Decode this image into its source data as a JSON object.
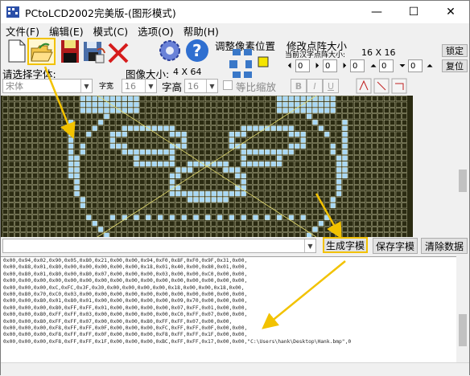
{
  "window": {
    "title": "PCtoLCD2002完美版-(图形模式)",
    "minimize": "—",
    "maximize": "☐",
    "close": "✕"
  },
  "menu": [
    "文件(F)",
    "编辑(E)",
    "模式(C)",
    "选项(O)",
    "帮助(H)"
  ],
  "toolbar": {
    "adjust_pixel_label": "调整像素位置",
    "resize_label": "修改点阵大小",
    "current_size_caption": "当前汉字点阵大小:",
    "current_size_value": "16 X 16",
    "lock_label": "锁定",
    "restore_label": "复位",
    "spin_values": [
      "0",
      "0",
      "0",
      "0",
      "0",
      "0",
      "0"
    ],
    "select_font_label": "请选择字体:",
    "font_value": "宋体",
    "char_width_label": "字宽",
    "char_width_value": "16",
    "image_size_label": "图像大小:",
    "image_size_value": "4 X 64",
    "char_height_label": "字高",
    "char_height_value": "16",
    "proportional_label": "等比缩放",
    "bold": "B",
    "italic": "I",
    "underline": "U"
  },
  "canvas": {
    "bg": "#2b2b12",
    "pixel_on": "#a9d8f5",
    "grid": "#f0f0c8"
  },
  "actions": {
    "generate": "生成字模",
    "save": "保存字模",
    "clear": "清除数据"
  },
  "output_lines": [
    "0x00,0x94,0x02,0x90,0x05,0x80,0x21,0x00,0x00,0x94,0xF0,0x8F,0xF0,0x9F,0x31,0x00,",
    "0x00,0x88,0x01,0x80,0x00,0x00,0x00,0x00,0x00,0x18,0x01,0x40,0x00,0x80,0x01,0x00,",
    "0x00,0x80,0x01,0x80,0x00,0x80,0x07,0x00,0x00,0x00,0x03,0x00,0x00,0xC0,0x00,0x00,",
    "0x00,0x00,0x00,0x00,0x00,0x00,0x00,0x00,0x00,0x00,0x00,0x00,0x00,0x00,0x00,0x00,",
    "0x00,0x00,0x00,0xC,0xFC,0x3F,0x30,0x00,0x00,0x00,0x00,0x18,0x00,0x00,0x18,0x00,",
    "0x00,0x80,0x70,0xC0,0x03,0x00,0x00,0x00,0x00,0x00,0x00,0x00,0x00,0x00,0x00,0x00,",
    "0x00,0x00,0x80,0x01,0x80,0x01,0x00,0x00,0x00,0x00,0x00,0x09,0x70,0x00,0x00,0x00,",
    "0x00,0x00,0x00,0x80,0xFF,0xFF,0x01,0x00,0x00,0x00,0x00,0x07,0xFF,0x01,0x00,0x00,",
    "0x00,0x00,0x80,0xFF,0xFF,0x03,0x00,0x00,0x00,0x00,0x00,0xC0,0xFF,0x07,0x00,0x00,",
    "0x00,0x00,0x80,0xFF,0xFF,0x07,0x00,0x00,0x00,0x80,0xFF,0xFF,0x07,0x00,0x00,",
    "0x00,0x00,0x00,0xF8,0xFF,0xFF,0x0F,0x00,0x00,0x00,0xFC,0xFF,0xFF,0x0F,0x00,0x00,",
    "0x00,0x00,0x00,0xF8,0xFF,0xFF,0x0F,0x00,0x00,0x00,0xF8,0xFF,0xFF,0x1F,0x00,0x00,",
    "0x00,0x00,0x00,0xF8,0xFF,0xFF,0x1F,0x00,0x00,0x00,0xBC,0xFF,0xFF,0x17,0x00,0x00,\"C:\\Users\\hank\\Desktop\\Hank.bmp\",0"
  ]
}
